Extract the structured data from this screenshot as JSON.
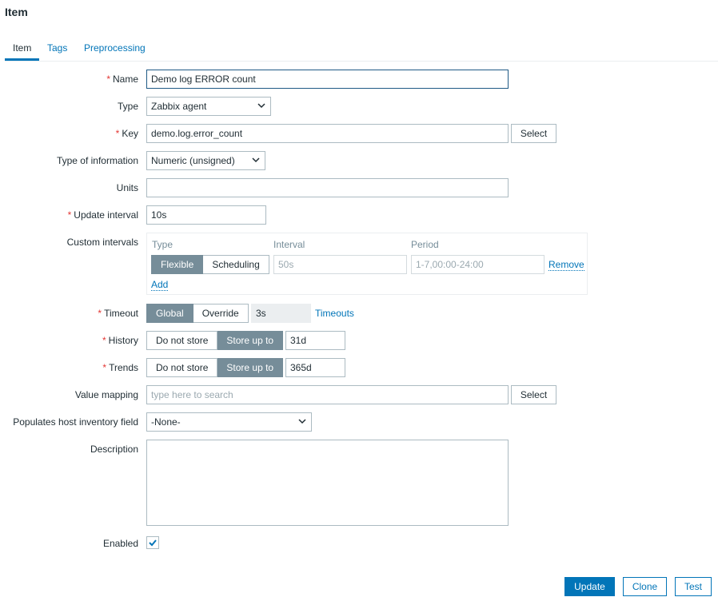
{
  "page": {
    "title": "Item"
  },
  "tabs": [
    {
      "label": "Item"
    },
    {
      "label": "Tags"
    },
    {
      "label": "Preprocessing"
    }
  ],
  "form": {
    "name": {
      "label": "Name",
      "value": "Demo log ERROR count"
    },
    "type": {
      "label": "Type",
      "selected": "Zabbix agent"
    },
    "key": {
      "label": "Key",
      "value": "demo.log.error_count",
      "button": "Select"
    },
    "type_of_information": {
      "label": "Type of information",
      "selected": "Numeric (unsigned)"
    },
    "units": {
      "label": "Units",
      "value": ""
    },
    "update_interval": {
      "label": "Update interval",
      "value": "10s"
    },
    "custom_intervals": {
      "label": "Custom intervals",
      "col_type": "Type",
      "col_interval": "Interval",
      "col_period": "Period",
      "type_options": [
        "Flexible",
        "Scheduling"
      ],
      "selected_type": "Flexible",
      "interval_placeholder": "50s",
      "period_placeholder": "1-7,00:00-24:00",
      "remove": "Remove",
      "add": "Add"
    },
    "timeout": {
      "label": "Timeout",
      "options": [
        "Global",
        "Override"
      ],
      "selected": "Global",
      "value": "3s",
      "link": "Timeouts"
    },
    "history": {
      "label": "History",
      "options": [
        "Do not store",
        "Store up to"
      ],
      "selected": "Store up to",
      "value": "31d"
    },
    "trends": {
      "label": "Trends",
      "options": [
        "Do not store",
        "Store up to"
      ],
      "selected": "Store up to",
      "value": "365d"
    },
    "value_mapping": {
      "label": "Value mapping",
      "placeholder": "type here to search",
      "button": "Select"
    },
    "inventory_field": {
      "label": "Populates host inventory field",
      "selected": "-None-"
    },
    "description": {
      "label": "Description",
      "value": ""
    },
    "enabled": {
      "label": "Enabled",
      "checked": true
    }
  },
  "actions": {
    "update": "Update",
    "clone": "Clone",
    "test": "Test"
  },
  "colors": {
    "accent": "#0275b8",
    "required": "#e33734",
    "segment_on": "#768d99"
  }
}
